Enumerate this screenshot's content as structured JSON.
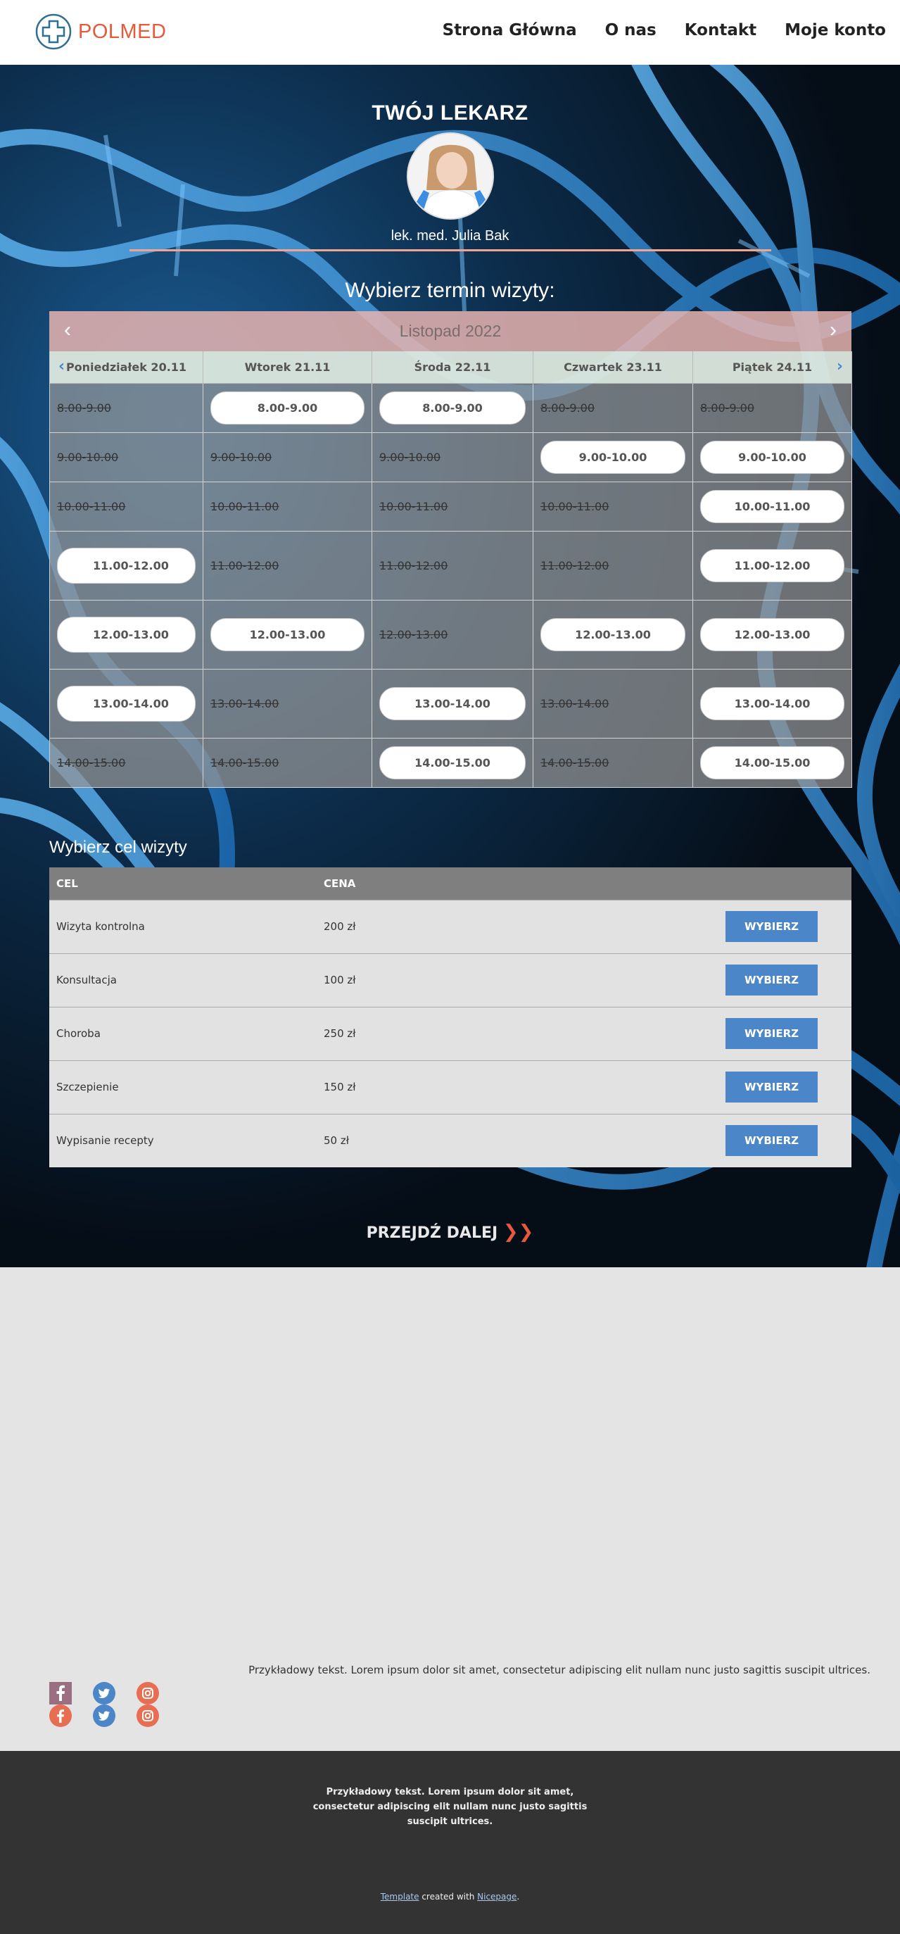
{
  "brand": {
    "name": "POLMED"
  },
  "nav": [
    "Strona Główna",
    "O nas",
    "Kontakt",
    "Moje konto"
  ],
  "doctor": {
    "heading": "TWÓJ LEKARZ",
    "name": "lek. med. Julia Bak"
  },
  "calendar": {
    "heading": "Wybierz termin wizyty:",
    "month": "Listopad 2022",
    "days": [
      "Poniedziałek 20.11",
      "Wtorek 21.11",
      "Środa 22.11",
      "Czwartek 23.11",
      "Piątek 24.11"
    ],
    "rows": [
      [
        {
          "t": "8.00-9.00",
          "a": false
        },
        {
          "t": "8.00-9.00",
          "a": true
        },
        {
          "t": "8.00-9.00",
          "a": true
        },
        {
          "t": "8.00-9.00",
          "a": false
        },
        {
          "t": "8.00-9.00",
          "a": false
        }
      ],
      [
        {
          "t": "9.00-10.00",
          "a": false
        },
        {
          "t": "9.00-10.00",
          "a": false
        },
        {
          "t": "9.00-10.00",
          "a": false
        },
        {
          "t": "9.00-10.00",
          "a": true
        },
        {
          "t": "9.00-10.00",
          "a": true
        }
      ],
      [
        {
          "t": "10.00-11.00",
          "a": false
        },
        {
          "t": "10.00-11.00",
          "a": false
        },
        {
          "t": "10.00-11.00",
          "a": false
        },
        {
          "t": "10.00-11.00",
          "a": false
        },
        {
          "t": "10.00-11.00",
          "a": true
        }
      ],
      [
        {
          "t": "11.00-12.00",
          "a": true
        },
        {
          "t": "11.00-12.00",
          "a": false
        },
        {
          "t": "11.00-12.00",
          "a": false
        },
        {
          "t": "11.00-12.00",
          "a": false
        },
        {
          "t": "11.00-12.00",
          "a": true
        }
      ],
      [
        {
          "t": "12.00-13.00",
          "a": true
        },
        {
          "t": "12.00-13.00",
          "a": true
        },
        {
          "t": "12.00-13.00",
          "a": false
        },
        {
          "t": "12.00-13.00",
          "a": true
        },
        {
          "t": "12.00-13.00",
          "a": true
        }
      ],
      [
        {
          "t": "13.00-14.00",
          "a": true
        },
        {
          "t": "13.00-14.00",
          "a": false
        },
        {
          "t": "13.00-14.00",
          "a": true
        },
        {
          "t": "13.00-14.00",
          "a": false
        },
        {
          "t": "13.00-14.00",
          "a": true
        }
      ],
      [
        {
          "t": "14.00-15.00",
          "a": false
        },
        {
          "t": "14.00-15.00",
          "a": false
        },
        {
          "t": "14.00-15.00",
          "a": true
        },
        {
          "t": "14.00-15.00",
          "a": false
        },
        {
          "t": "14.00-15.00",
          "a": true
        }
      ]
    ]
  },
  "purpose": {
    "heading": "Wybierz cel wizyty",
    "col_goal": "CEL",
    "col_price": "CENA",
    "button_label": "WYBIERZ",
    "items": [
      {
        "goal": "Wizyta kontrolna",
        "price": "200 zł"
      },
      {
        "goal": "Konsultacja",
        "price": "100 zł"
      },
      {
        "goal": "Choroba",
        "price": "250 zł"
      },
      {
        "goal": "Szczepienie",
        "price": "150 zł"
      },
      {
        "goal": "Wypisanie recepty",
        "price": "50 zł"
      }
    ]
  },
  "next_label": "PRZEJDŹ DALEJ",
  "sample_text": "Przykładowy tekst. Lorem ipsum dolor sit amet, consectetur adipiscing elit nullam nunc justo sagittis suscipit ultrices.",
  "footer": {
    "text": "Przykładowy tekst. Lorem ipsum dolor sit amet, consectetur adipiscing elit nullam nunc justo sagittis suscipit ultrices.",
    "credit_template": "Template",
    "credit_mid": " created with ",
    "credit_nicepage": "Nicepage",
    "credit_end": "."
  },
  "colors": {
    "accent": "#e8583a",
    "button": "#4a86c8",
    "divider": "#f1a590",
    "footer": "#333333"
  }
}
